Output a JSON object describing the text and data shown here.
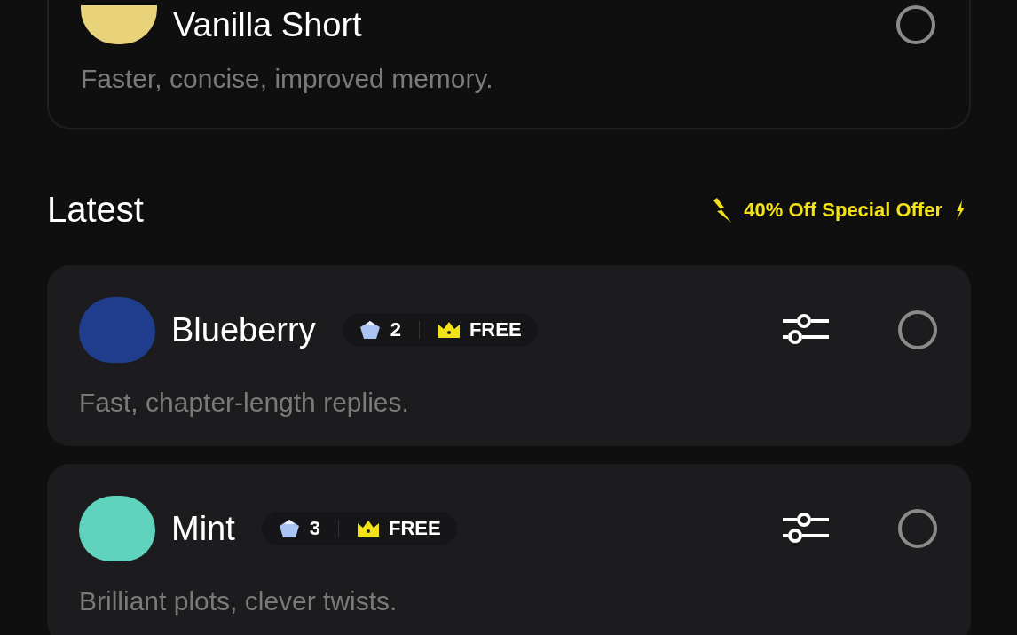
{
  "top_model": {
    "name": "Vanilla Short",
    "color": "#e8d27a",
    "description": "Faster, concise, improved memory.",
    "selected": false
  },
  "section": {
    "title": "Latest",
    "offer": "40% Off Special Offer"
  },
  "models": [
    {
      "name": "Blueberry",
      "color": "#1f3d8c",
      "gems": "2",
      "tier": "FREE",
      "description": "Fast, chapter-length replies.",
      "selected": false
    },
    {
      "name": "Mint",
      "color": "#5fd3bd",
      "gems": "3",
      "tier": "FREE",
      "description": "Brilliant plots, clever twists.",
      "selected": false
    }
  ]
}
